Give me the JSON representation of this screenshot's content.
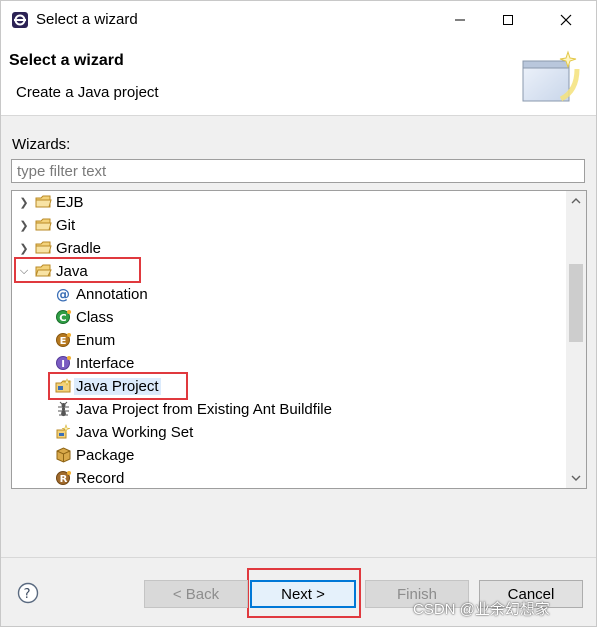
{
  "window": {
    "title": "Select a wizard"
  },
  "header": {
    "title": "Select a wizard",
    "description": "Create a Java project"
  },
  "wizards": {
    "label": "Wizards:",
    "filter_placeholder": "type filter text",
    "filter_value": "",
    "items": [
      {
        "label": "EJB",
        "type": "folder",
        "expanded": false,
        "level": 0
      },
      {
        "label": "Git",
        "type": "folder",
        "expanded": false,
        "level": 0
      },
      {
        "label": "Gradle",
        "type": "folder",
        "expanded": false,
        "level": 0
      },
      {
        "label": "Java",
        "type": "folder",
        "expanded": true,
        "level": 0
      },
      {
        "label": "Annotation",
        "type": "annotation",
        "level": 1
      },
      {
        "label": "Class",
        "type": "class",
        "level": 1
      },
      {
        "label": "Enum",
        "type": "enum",
        "level": 1
      },
      {
        "label": "Interface",
        "type": "interface",
        "level": 1
      },
      {
        "label": "Java Project",
        "type": "java-project",
        "level": 1,
        "selected": true
      },
      {
        "label": "Java Project from Existing Ant Buildfile",
        "type": "ant",
        "level": 1
      },
      {
        "label": "Java Working Set",
        "type": "working-set",
        "level": 1
      },
      {
        "label": "Package",
        "type": "package",
        "level": 1
      },
      {
        "label": "Record",
        "type": "record",
        "level": 1
      }
    ]
  },
  "buttons": {
    "back": "< Back",
    "next": "Next >",
    "finish": "Finish",
    "cancel": "Cancel",
    "help": "?"
  },
  "watermark": "CSDN @业余幻想家",
  "colors": {
    "highlight_box": "#e0393e",
    "selection": "#dcebfc",
    "default_button_border": "#0078d7"
  }
}
